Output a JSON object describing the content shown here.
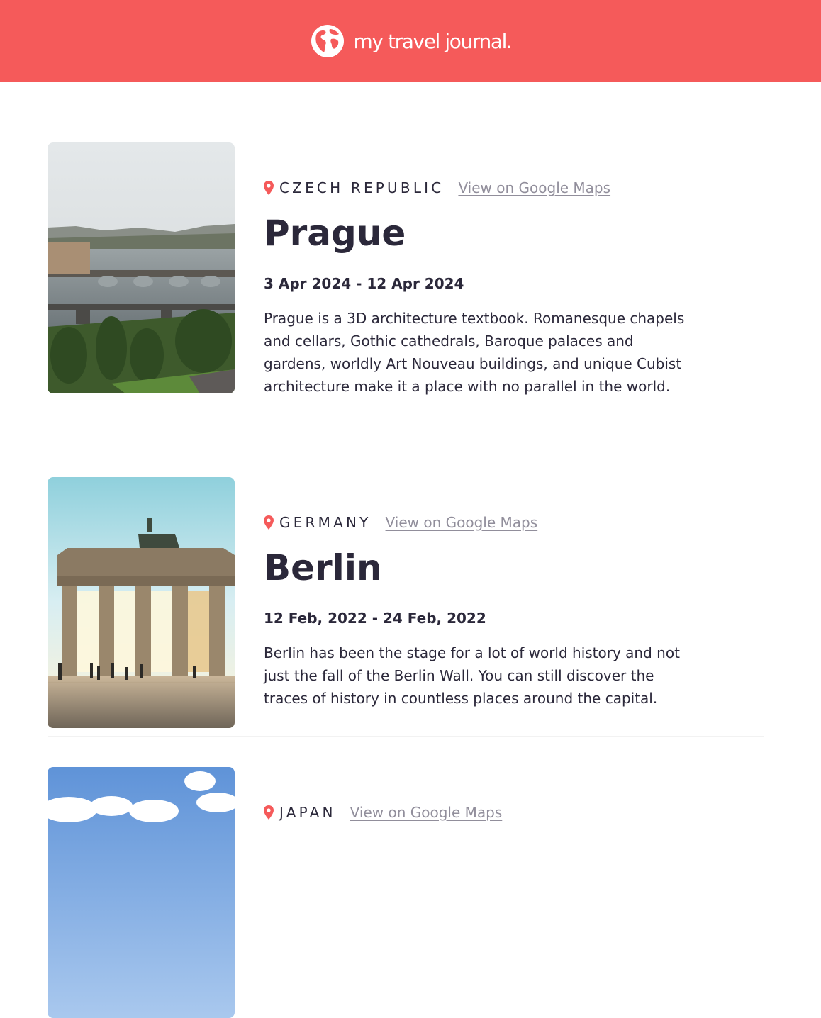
{
  "header": {
    "title": "my travel journal.",
    "logo_icon": "globe-icon"
  },
  "link_label": "View on Google Maps",
  "entries": [
    {
      "country": "CZECH REPUBLIC",
      "city": "Prague",
      "dates": "3 Apr 2024 - 12 Apr 2024",
      "description": "Prague is a 3D architecture textbook. Romanesque chapels and cellars, Gothic cathedrals, Baroque palaces and gardens, worldly Art Nouveau buildings, and unique Cubist architecture make it a place with no parallel in the world."
    },
    {
      "country": "GERMANY",
      "city": "Berlin",
      "dates": "12 Feb, 2022 - 24 Feb, 2022",
      "description": "Berlin has been the stage for a lot of world history and not just the fall of the Berlin Wall. You can still discover the traces of history in countless places around the capital."
    },
    {
      "country": "JAPAN",
      "city": "",
      "dates": "",
      "description": ""
    }
  ],
  "colors": {
    "header_bg": "#f55a5a",
    "pin": "#f55a5a",
    "link": "#918e9b",
    "text": "#2b283a"
  }
}
